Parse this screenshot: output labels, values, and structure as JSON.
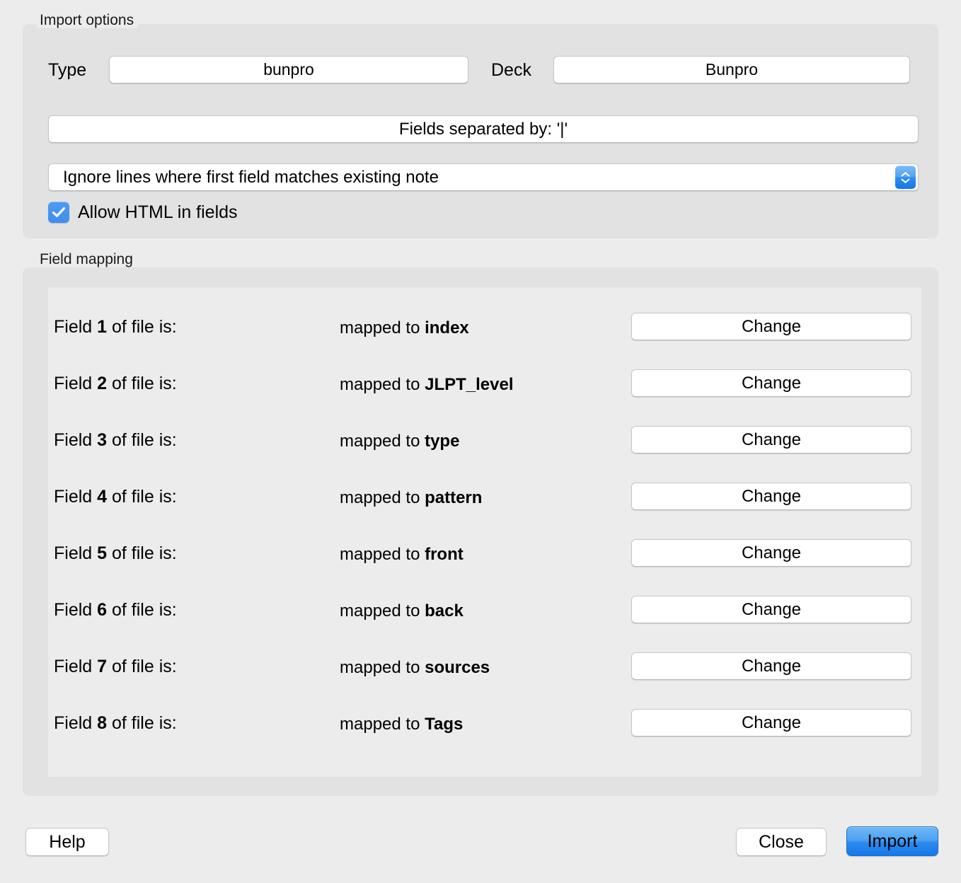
{
  "import_options": {
    "title": "Import options",
    "type_label": "Type",
    "type_value": "bunpro",
    "deck_label": "Deck",
    "deck_value": "Bunpro",
    "separator_button_label": "Fields separated by: '|'",
    "import_mode_selected": "Ignore lines where first field matches existing note",
    "allow_html_label": "Allow HTML in fields",
    "allow_html_checked": true
  },
  "field_mapping": {
    "title": "Field mapping",
    "change_label": "Change",
    "rows": [
      {
        "field_prefix": "Field ",
        "number": "1",
        "field_suffix": " of file is:",
        "mapped_prefix": "mapped to ",
        "target": "index"
      },
      {
        "field_prefix": "Field ",
        "number": "2",
        "field_suffix": " of file is:",
        "mapped_prefix": "mapped to ",
        "target": "JLPT_level"
      },
      {
        "field_prefix": "Field ",
        "number": "3",
        "field_suffix": " of file is:",
        "mapped_prefix": "mapped to ",
        "target": "type"
      },
      {
        "field_prefix": "Field ",
        "number": "4",
        "field_suffix": " of file is:",
        "mapped_prefix": "mapped to ",
        "target": "pattern"
      },
      {
        "field_prefix": "Field ",
        "number": "5",
        "field_suffix": " of file is:",
        "mapped_prefix": "mapped to ",
        "target": "front"
      },
      {
        "field_prefix": "Field ",
        "number": "6",
        "field_suffix": " of file is:",
        "mapped_prefix": "mapped to ",
        "target": "back"
      },
      {
        "field_prefix": "Field ",
        "number": "7",
        "field_suffix": " of file is:",
        "mapped_prefix": "mapped to ",
        "target": "sources"
      },
      {
        "field_prefix": "Field ",
        "number": "8",
        "field_suffix": " of file is:",
        "mapped_prefix": "mapped to ",
        "target": "Tags"
      }
    ]
  },
  "footer": {
    "help_label": "Help",
    "close_label": "Close",
    "import_label": "Import"
  },
  "icons": {
    "checkmark": "check-icon",
    "chevron_up": "chevron-up-icon",
    "chevron_down": "chevron-down-icon"
  },
  "colors": {
    "page_background": "#ececec",
    "group_background": "#e2e2e2",
    "panel_background": "#ececec",
    "accent_blue": "#2b8bef",
    "checkbox_blue": "#4490ee"
  }
}
